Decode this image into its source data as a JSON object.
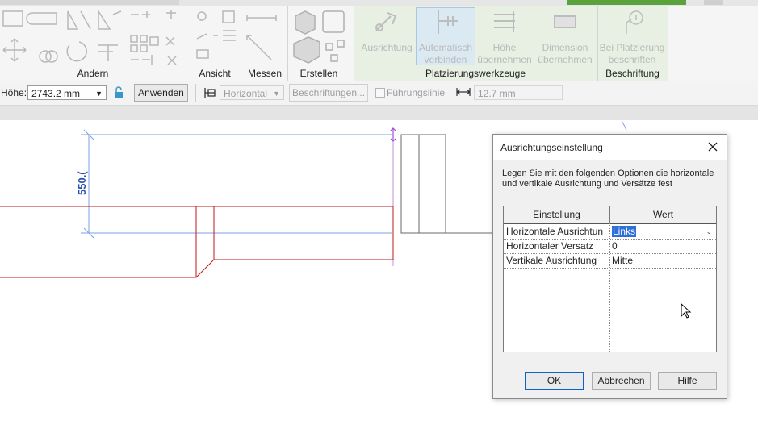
{
  "ribbon": {
    "panels": {
      "aendern": "Ändern",
      "ansicht": "Ansicht",
      "messen": "Messen",
      "erstellen": "Erstellen",
      "platzierungswerkzeuge": "Platzierungswerkzeuge",
      "beschriftung": "Beschriftung"
    },
    "buttons": {
      "ausrichtung": "Ausrichtung",
      "automatisch_verbinden_1": "Automatisch",
      "automatisch_verbinden_2": "verbinden",
      "hoehe_1": "Höhe",
      "hoehe_2": "übernehmen",
      "dimension_1": "Dimension",
      "dimension_2": "übernehmen",
      "bei_platzierung_1": "Bei Platzierung",
      "bei_platzierung_2": "beschriften"
    },
    "colors": {
      "context_tab": "#5aa33c",
      "context_panel": "#e8efe3"
    }
  },
  "options_bar": {
    "hoehe_label": "Höhe:",
    "hoehe_value": "2743.2 mm",
    "anwenden": "Anwenden",
    "horizontal": "Horizontal",
    "beschriftungen": "Beschriftungen...",
    "fuehrungslinie": "Führungslinie",
    "abstand_value": "12.7 mm"
  },
  "drawing": {
    "dimension_text": "550.("
  },
  "dialog": {
    "title": "Ausrichtungseinstellung",
    "description_1": "Legen Sie mit den folgenden Optionen die horizontale",
    "description_2": "und vertikale Ausrichtung und Versätze fest",
    "columns": [
      "Einstellung",
      "Wert"
    ],
    "rows": [
      {
        "setting": "Horizontale Ausrichtun",
        "value": "Links"
      },
      {
        "setting": "Horizontaler Versatz",
        "value": "0"
      },
      {
        "setting": "Vertikale Ausrichtung",
        "value": "Mitte"
      }
    ],
    "ok": "OK",
    "abbrechen": "Abbrechen",
    "hilfe": "Hilfe"
  }
}
